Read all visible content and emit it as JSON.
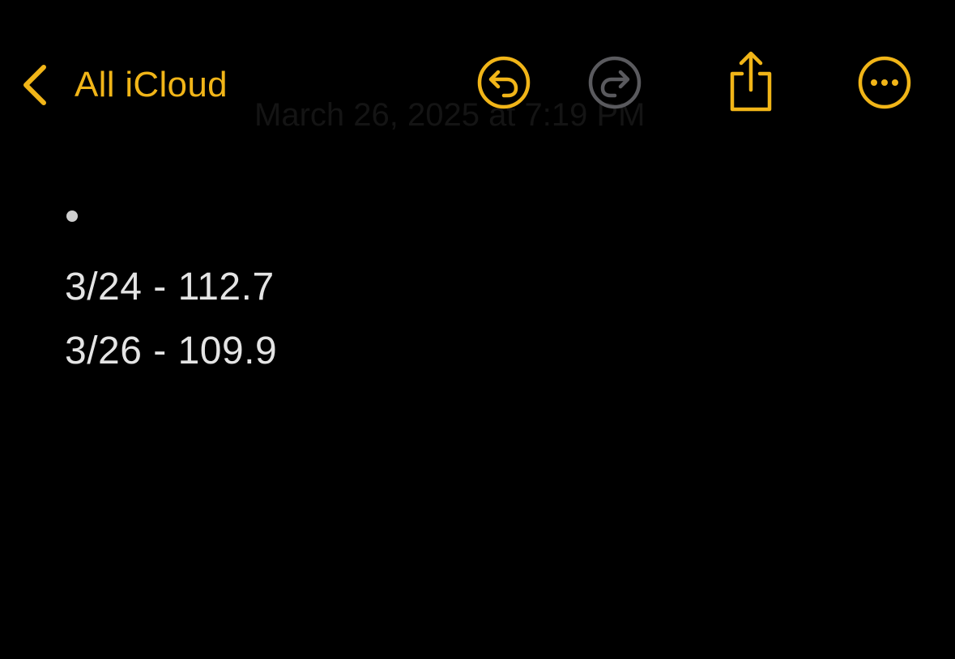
{
  "navigation": {
    "back_label": "All iCloud",
    "note_date": "March 26, 2025 at 7:19 PM"
  },
  "toolbar": {
    "undo_icon": "undo-icon",
    "redo_icon": "redo-icon",
    "share_icon": "share-icon",
    "more_icon": "more-icon"
  },
  "note": {
    "lines": [
      "3/24 - 112.7",
      "3/26 - 109.9"
    ]
  },
  "colors": {
    "accent": "#f1b518",
    "disabled": "#5a5a5e",
    "background": "#000000",
    "text": "#e4e4e4"
  }
}
